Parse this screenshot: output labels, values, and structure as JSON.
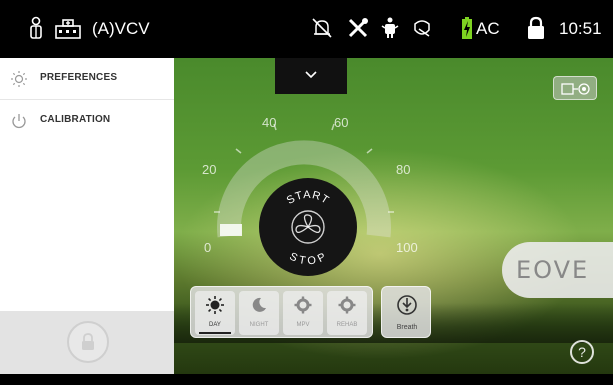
{
  "status_bar": {
    "mode_label": "(A)VCV",
    "power_label": "AC",
    "time": "10:51",
    "icons": [
      "patient-icon",
      "hospital-icon",
      "alarm-silenced-icon",
      "tools-icon",
      "ventilator-icon",
      "mask-icon",
      "battery-charging-icon",
      "lock-icon"
    ]
  },
  "side_menu": {
    "items": [
      {
        "label": "PREFERENCES",
        "icon": "sun-settings-icon"
      },
      {
        "label": "CALIBRATION",
        "icon": "power-icon"
      }
    ],
    "lock_icon": "lock-icon"
  },
  "dial": {
    "tick_labels": [
      "0",
      "20",
      "40",
      "60",
      "80",
      "100"
    ],
    "start_label": "START",
    "stop_label": "STOP",
    "center_icon": "fan-icon"
  },
  "modes": {
    "items": [
      {
        "label": "DAY",
        "icon": "sun-icon",
        "active": true
      },
      {
        "label": "NIGHT",
        "icon": "moon-icon",
        "active": false
      },
      {
        "label": "MPV",
        "icon": "gear-icon",
        "active": false
      },
      {
        "label": "REHAB",
        "icon": "gear-icon",
        "active": false
      }
    ],
    "breath_label": "Breath"
  },
  "brand": "EOVE",
  "help_label": "?",
  "colors": {
    "status_bar": "#000000",
    "battery_charge": "#7ed321",
    "panel_bg": "#ffffff"
  }
}
